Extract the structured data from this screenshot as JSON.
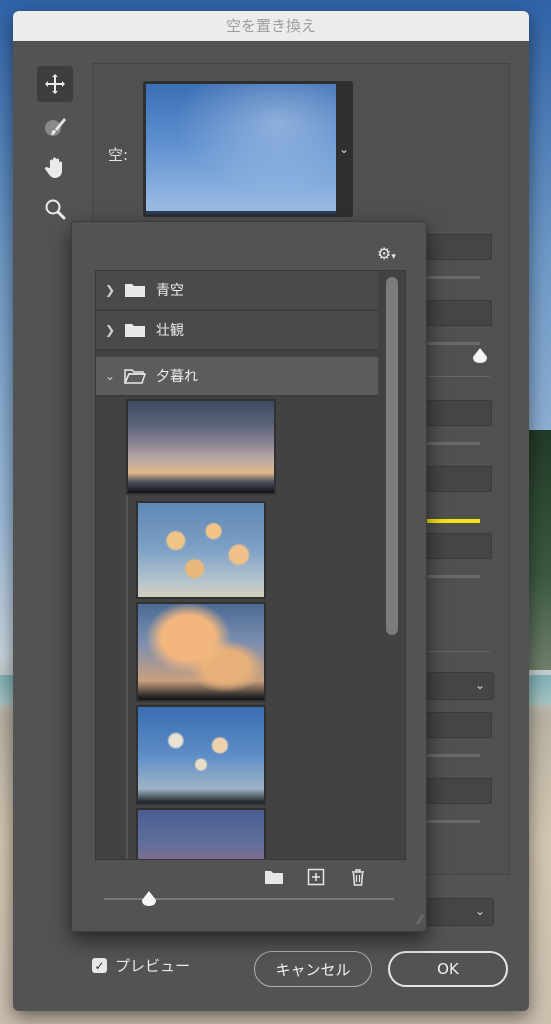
{
  "dialog": {
    "title": "空を置き換え"
  },
  "tools": [
    {
      "name": "move-tool",
      "icon": "move-icon",
      "active": true
    },
    {
      "name": "sky-brush-tool",
      "icon": "sky-brush-icon",
      "active": false
    },
    {
      "name": "hand-tool",
      "icon": "hand-icon",
      "active": false
    },
    {
      "name": "zoom-tool",
      "icon": "zoom-icon",
      "active": false
    }
  ],
  "sky": {
    "label": "空:"
  },
  "library": {
    "folders": [
      {
        "label": "青空",
        "open": false
      },
      {
        "label": "壮観",
        "open": false
      },
      {
        "label": "夕暮れ",
        "open": true
      }
    ],
    "actions": [
      "new-folder-icon",
      "add-sky-icon",
      "trash-icon"
    ]
  },
  "footer": {
    "preview_label": "プレビュー",
    "preview_checked": true,
    "cancel_label": "キャンセル",
    "ok_label": "OK"
  },
  "colors": {
    "dialog_bg": "#535353",
    "accent_yellow": "#f6e313"
  }
}
